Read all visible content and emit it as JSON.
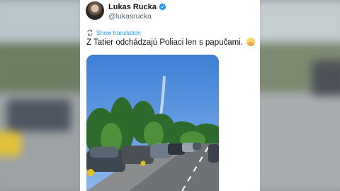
{
  "tweet": {
    "author_name": "Lukas Rucka",
    "author_handle": "@lukasrucka",
    "translate_label": "Show translation",
    "text": "Z Tatier odchádzajú Poliaci len s papučami.",
    "emoji_icon": "shushing-face-emoji",
    "verified_color": "#1d9bf0"
  },
  "icons": {
    "avatar": "avatar",
    "verified": "verified-badge-icon",
    "translate": "translate-icon"
  },
  "media": {
    "description_icon": "video-thumbnail"
  }
}
